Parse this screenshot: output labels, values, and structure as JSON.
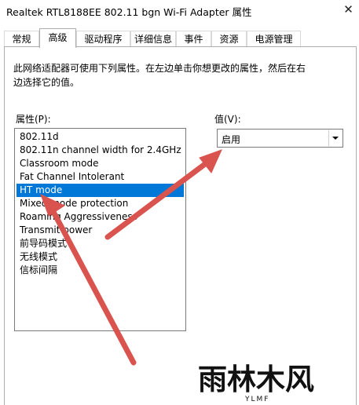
{
  "window": {
    "title": "Realtek RTL8188EE 802.11 bgn Wi-Fi Adapter 属性",
    "close": "✕"
  },
  "tabs": [
    {
      "label": "常规"
    },
    {
      "label": "高级"
    },
    {
      "label": "驱动程序"
    },
    {
      "label": "详细信息"
    },
    {
      "label": "事件"
    },
    {
      "label": "资源"
    },
    {
      "label": "电源管理"
    }
  ],
  "active_tab": "高级",
  "description": {
    "line1": "此网络适配器可使用下列属性。在左边单击你想更改的属性，然后在右",
    "line2": "边选择它的值。"
  },
  "property": {
    "label": "属性(P):",
    "items": [
      "802.11d",
      "802.11n channel width for 2.4GHz",
      "Classroom mode",
      "Fat Channel Intolerant",
      "HT mode",
      "Mixed mode protection",
      "Roaming Aggressiveness",
      "Transmit power",
      "前导码模式",
      "无线模式",
      "信标间隔"
    ],
    "selected": "HT mode"
  },
  "value": {
    "label": "值(V):",
    "selected": "启用"
  },
  "watermark": {
    "text": "雨林木风",
    "sub": "YLMF"
  },
  "colors": {
    "selection": "#0078d7",
    "annotation_arrow": "#d9534f"
  },
  "icons": {
    "close": "close-icon",
    "dropdown": "chevron-down-icon"
  }
}
